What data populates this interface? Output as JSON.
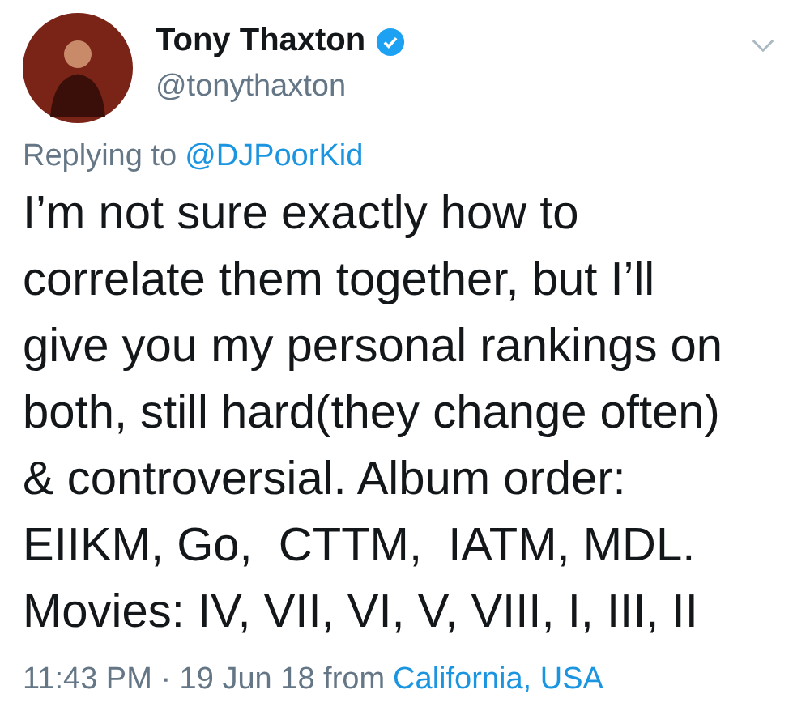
{
  "author": {
    "name": "Tony Thaxton",
    "verified": true,
    "handle": "@tonythaxton"
  },
  "reply": {
    "prefix": "Replying to",
    "mention": "@DJPoorKid"
  },
  "body_lines": [
    "I’m not sure exactly how to",
    "correlate them together, but I’ll",
    "give you my personal rankings on",
    "both, still hard(they change often)",
    "& controversial. Album order:",
    "EIIKM, Go,  CTTM,  IATM, MDL.",
    "Movies: IV, VII, VI, V, VIII, I, III, II"
  ],
  "footer": {
    "timestamp": "11:43 PM · 19 Jun 18 from",
    "location": "California, USA"
  }
}
